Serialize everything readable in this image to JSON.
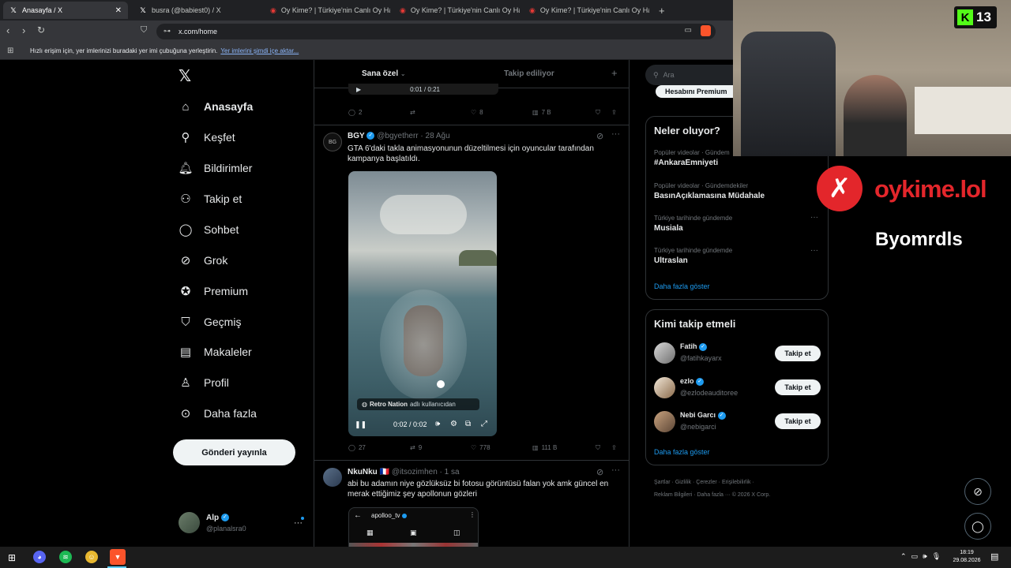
{
  "browser": {
    "tabs": [
      {
        "title": "Anasayfa / X",
        "icon": "x-logo-icon"
      },
      {
        "title": "busra (@babiest0) / X",
        "icon": "x-logo-icon"
      },
      {
        "title": "Oy Kime? | Türkiye'nin Canlı Oy Harit",
        "icon": "oykime-icon"
      },
      {
        "title": "Oy Kime? | Türkiye'nin Canlı Oy Harit",
        "icon": "oykime-icon"
      },
      {
        "title": "Oy Kime? | Türkiye'nin Canlı Oy Harit",
        "icon": "oykime-icon"
      }
    ],
    "url": "x.com/home",
    "bookmarks_bar_text": "Hızlı erişim için, yer imlerinizi buradaki yer imi çubuğuna yerleştirin.",
    "bookmarks_bar_link": "Yer imlerini şimdi içe aktar..."
  },
  "sidebar": {
    "items": [
      {
        "label": "Anasayfa",
        "icon": "home-icon"
      },
      {
        "label": "Keşfet",
        "icon": "search-icon"
      },
      {
        "label": "Bildirimler",
        "icon": "bell-icon"
      },
      {
        "label": "Takip et",
        "icon": "person-add-icon"
      },
      {
        "label": "Sohbet",
        "icon": "chat-icon"
      },
      {
        "label": "Grok",
        "icon": "grok-icon"
      },
      {
        "label": "Premium",
        "icon": "verified-icon"
      },
      {
        "label": "Geçmiş",
        "icon": "bookmark-icon"
      },
      {
        "label": "Makaleler",
        "icon": "article-icon"
      },
      {
        "label": "Profil",
        "icon": "profile-icon"
      },
      {
        "label": "Daha fazla",
        "icon": "more-circle-icon"
      }
    ],
    "post_button": "Gönderi yayınla",
    "account": {
      "name": "Alp",
      "handle": "@planalsra0"
    }
  },
  "feed": {
    "tabs": [
      "Sana özel",
      "Takip ediliyor"
    ],
    "top_stats": {
      "replies": "2",
      "likes": "8",
      "views": "7 B",
      "video_time": "0:01 / 0:21"
    },
    "post1": {
      "name": "BGY",
      "handle": "@bgyetherr",
      "date": "· 28 Ağu",
      "text": "GTA 6'daki takla animasyonunun düzeltilmesi için oyuncular tarafından kampanya başlatıldı.",
      "video_source_name": "Retro Nation",
      "video_source_suffix": "adlı kullanıcıdan",
      "video_time": "0:02 / 0:02",
      "replies": "27",
      "reposts": "9",
      "likes": "778",
      "views": "111 B"
    },
    "post2": {
      "name": "NkuNku",
      "flag": "🇫🇷",
      "handle": "@itsozimhen",
      "date": "· 1 sa",
      "text": "abi bu adamın niye gözlüksüz bi fotosu görüntüsü falan yok amk güncel en merak ettiğimiz şey apollonun gözleri",
      "embed_name": "apolloo_tv"
    }
  },
  "right": {
    "search_placeholder": "Ara",
    "premium_button": "Hesabını Premium",
    "trends_title": "Neler oluyor?",
    "trends": [
      {
        "meta": "Popüler videolar · Gündem",
        "name": "#AnkaraEmniyeti"
      },
      {
        "meta": "Popüler videolar · Gündemdekiler",
        "name": "BasınAçıklamasına Müdahale"
      },
      {
        "meta": "Türkiye tarihinde gündemde",
        "name": "Musiala"
      },
      {
        "meta": "Türkiye tarihinde gündemde",
        "name": "Ultraslan"
      }
    ],
    "trends_more": "Daha fazla göster",
    "who_title": "Kimi takip etmeli",
    "who": [
      {
        "name": "Fatih",
        "handle": "@fatihkayarx",
        "button": "Takip et"
      },
      {
        "name": "ezlo",
        "handle": "@ezlodeauditoree",
        "button": "Takip et"
      },
      {
        "name": "Nebi Garcı",
        "handle": "@nebigarci",
        "button": "Takip et"
      }
    ],
    "who_more": "Daha fazla göster",
    "footer_line1": "Şartlar · Gizlilik · Çerezler · Erişilebilirlik ·",
    "footer_line2": "Reklam Bilgileri · Daha fazla ··· © 2026 X Corp."
  },
  "overlay": {
    "kick_count": "13",
    "brand": "oykime.lol",
    "username": "Byomrdls"
  },
  "taskbar": {
    "time": "18:19",
    "date": "29.08.2026"
  },
  "colors": {
    "accent_blue": "#1d9bf0",
    "kick_green": "#53fc18",
    "brand_red": "#e3262b"
  }
}
